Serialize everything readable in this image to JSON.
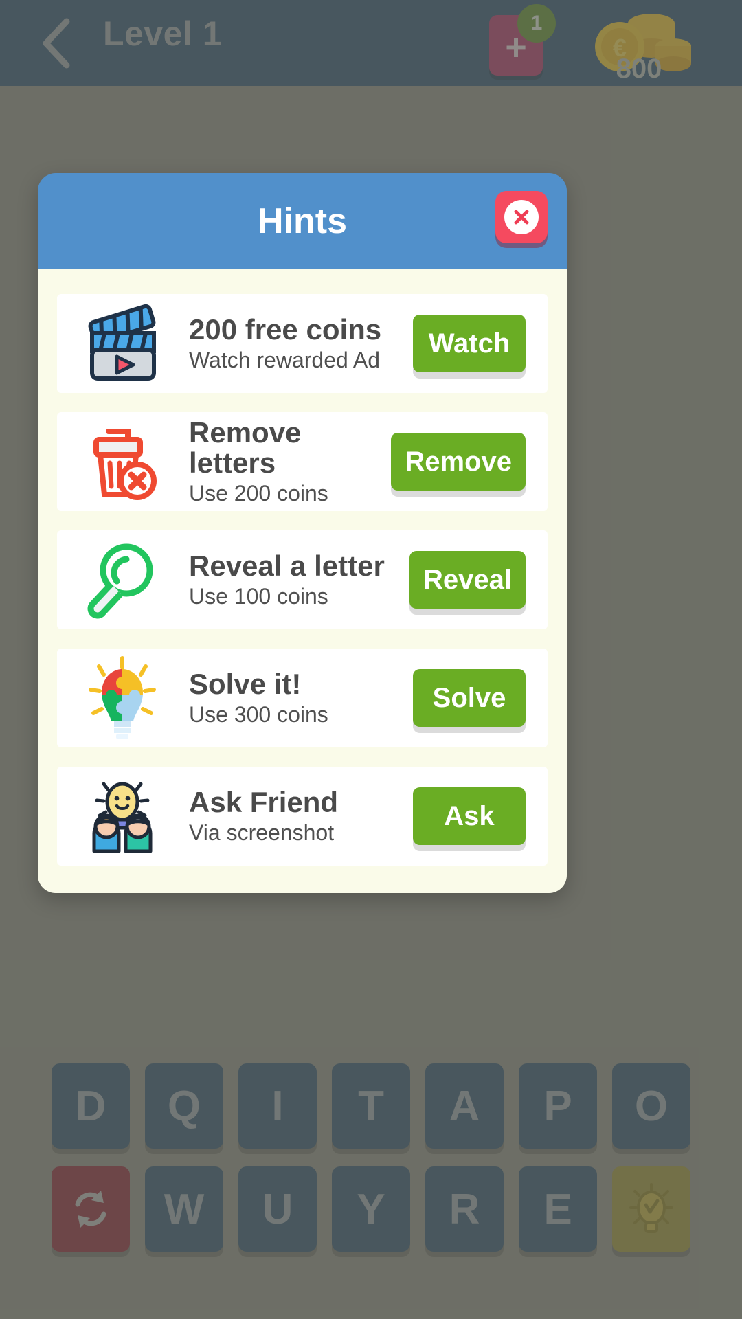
{
  "header": {
    "back_icon": "chevron-left-icon",
    "title": "Level 1",
    "add_button": {
      "icon": "plus-icon",
      "glyph": "+",
      "badge": "1"
    },
    "coins": {
      "icon": "coin-stack-icon",
      "amount": "800"
    }
  },
  "dialog": {
    "title": "Hints",
    "close_icon": "close-icon",
    "rows": [
      {
        "icon": "clapperboard-icon",
        "title": "200 free coins",
        "subtitle": "Watch rewarded Ad",
        "action": "Watch"
      },
      {
        "icon": "trash-remove-icon",
        "title": "Remove letters",
        "subtitle": "Use 200 coins",
        "action": "Remove"
      },
      {
        "icon": "magnifier-icon",
        "title": "Reveal a letter",
        "subtitle": "Use 100 coins",
        "action": "Reveal"
      },
      {
        "icon": "puzzle-bulb-icon",
        "title": "Solve it!",
        "subtitle": "Use 300 coins",
        "action": "Solve"
      },
      {
        "icon": "friends-bulb-icon",
        "title": "Ask Friend",
        "subtitle": "Via screenshot",
        "action": "Ask"
      }
    ]
  },
  "keyboard": {
    "row1": [
      "D",
      "Q",
      "I",
      "T",
      "A",
      "P",
      "O"
    ],
    "row2_letters": [
      "W",
      "U",
      "Y",
      "R",
      "E"
    ],
    "shuffle_icon": "shuffle-icon",
    "hint_icon": "lightbulb-icon"
  },
  "colors": {
    "header_bg": "#2b5072",
    "dialog_header": "#5190cb",
    "dialog_body": "#fafbe9",
    "action_green": "#6aad24",
    "close_red": "#f54a5f",
    "plus_magenta": "#b0336a",
    "badge_green": "#5f8e2e",
    "key_blue": "#2e5070",
    "key_shuffle_red": "#8d2236",
    "key_hint_olive": "#9b9036"
  }
}
